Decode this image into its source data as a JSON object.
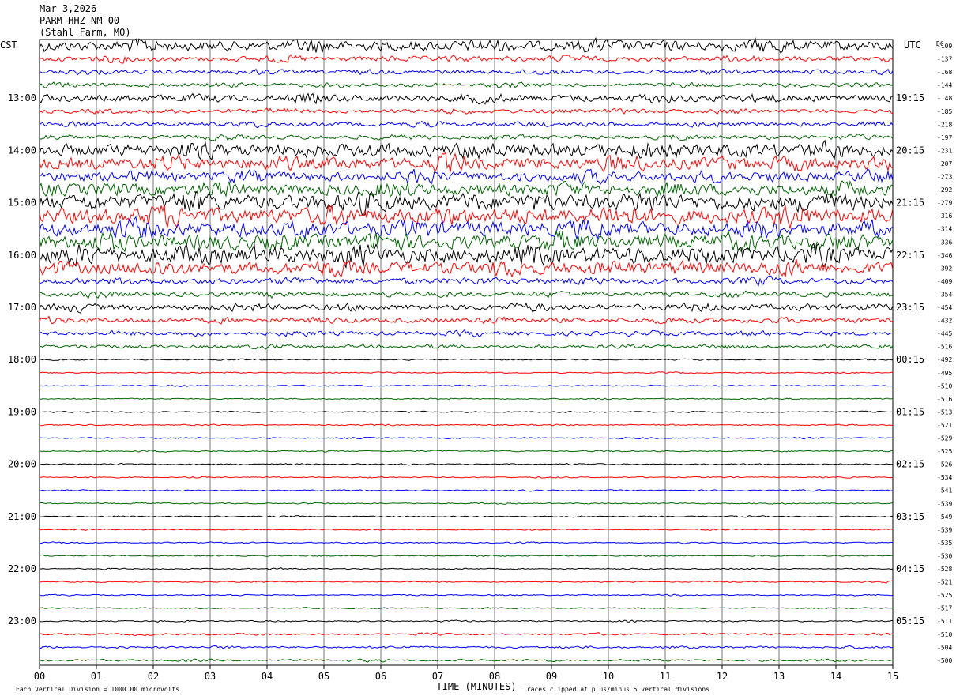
{
  "header": {
    "date": "Mar 3,2026",
    "station": "PARM HHZ NM 00",
    "location": "(Stahl Farm, MO)"
  },
  "chart_data": {
    "type": "line",
    "chart_kind": "helicorder seismogram",
    "left_axis_title": "CST",
    "right_axis_title": "UTC",
    "dc_title": "DC",
    "xlabel": "TIME (MINUTES)",
    "x_ticks": [
      "00",
      "01",
      "02",
      "03",
      "04",
      "05",
      "06",
      "07",
      "08",
      "09",
      "10",
      "11",
      "12",
      "13",
      "14",
      "15"
    ],
    "xlim": [
      0,
      15
    ],
    "trace_minutes": 15,
    "trace_count": 48,
    "trace_colors": [
      "#000000",
      "#ff0000",
      "#0000ff",
      "#006400"
    ],
    "cst_hour_labels": [
      {
        "trace": 4,
        "label": "13:00"
      },
      {
        "trace": 8,
        "label": "14:00"
      },
      {
        "trace": 12,
        "label": "15:00"
      },
      {
        "trace": 16,
        "label": "16:00"
      },
      {
        "trace": 20,
        "label": "17:00"
      },
      {
        "trace": 24,
        "label": "18:00"
      },
      {
        "trace": 28,
        "label": "19:00"
      },
      {
        "trace": 32,
        "label": "20:00"
      },
      {
        "trace": 36,
        "label": "21:00"
      },
      {
        "trace": 40,
        "label": "22:00"
      },
      {
        "trace": 44,
        "label": "23:00"
      }
    ],
    "utc_hour_labels": [
      {
        "trace": 4,
        "label": "19:15"
      },
      {
        "trace": 8,
        "label": "20:15"
      },
      {
        "trace": 12,
        "label": "21:15"
      },
      {
        "trace": 16,
        "label": "22:15"
      },
      {
        "trace": 20,
        "label": "23:15"
      },
      {
        "trace": 24,
        "label": "00:15"
      },
      {
        "trace": 28,
        "label": "01:15"
      },
      {
        "trace": 32,
        "label": "02:15"
      },
      {
        "trace": 36,
        "label": "03:15"
      },
      {
        "trace": 40,
        "label": "04:15"
      },
      {
        "trace": 44,
        "label": "05:15"
      }
    ],
    "dc_offsets": [
      "-109",
      "-137",
      "-168",
      "-144",
      "-148",
      "-185",
      "-218",
      "-197",
      "-231",
      "-207",
      "-273",
      "-292",
      "-279",
      "-316",
      "-314",
      "-336",
      "-346",
      "-392",
      "-409",
      "-354",
      "-454",
      "-432",
      "-445",
      "-516",
      "-492",
      "-495",
      "-510",
      "-516",
      "-513",
      "-521",
      "-529",
      "-525",
      "-526",
      "-534",
      "-541",
      "-539",
      "-549",
      "-539",
      "-535",
      "-530",
      "-528",
      "-521",
      "-525",
      "-517",
      "-511",
      "-510",
      "-504",
      "-500"
    ],
    "relative_amplitude": [
      3.2,
      1.6,
      1.3,
      1.2,
      2.2,
      1.3,
      1.3,
      1.3,
      4.0,
      3.8,
      3.0,
      3.6,
      4.8,
      4.8,
      4.4,
      4.4,
      5.0,
      3.8,
      1.9,
      1.5,
      1.9,
      1.5,
      1.3,
      1.0,
      0.35,
      0.35,
      0.35,
      0.35,
      0.35,
      0.35,
      0.35,
      0.35,
      0.35,
      0.35,
      0.35,
      0.35,
      0.35,
      0.35,
      0.35,
      0.35,
      0.35,
      0.35,
      0.35,
      0.35,
      0.4,
      0.55,
      0.6,
      0.6
    ],
    "footer_left": "Each Vertical Division = 1000.00 microvolts",
    "footer_right": "Traces clipped at plus/minus 5 vertical divisions",
    "grid": true
  }
}
